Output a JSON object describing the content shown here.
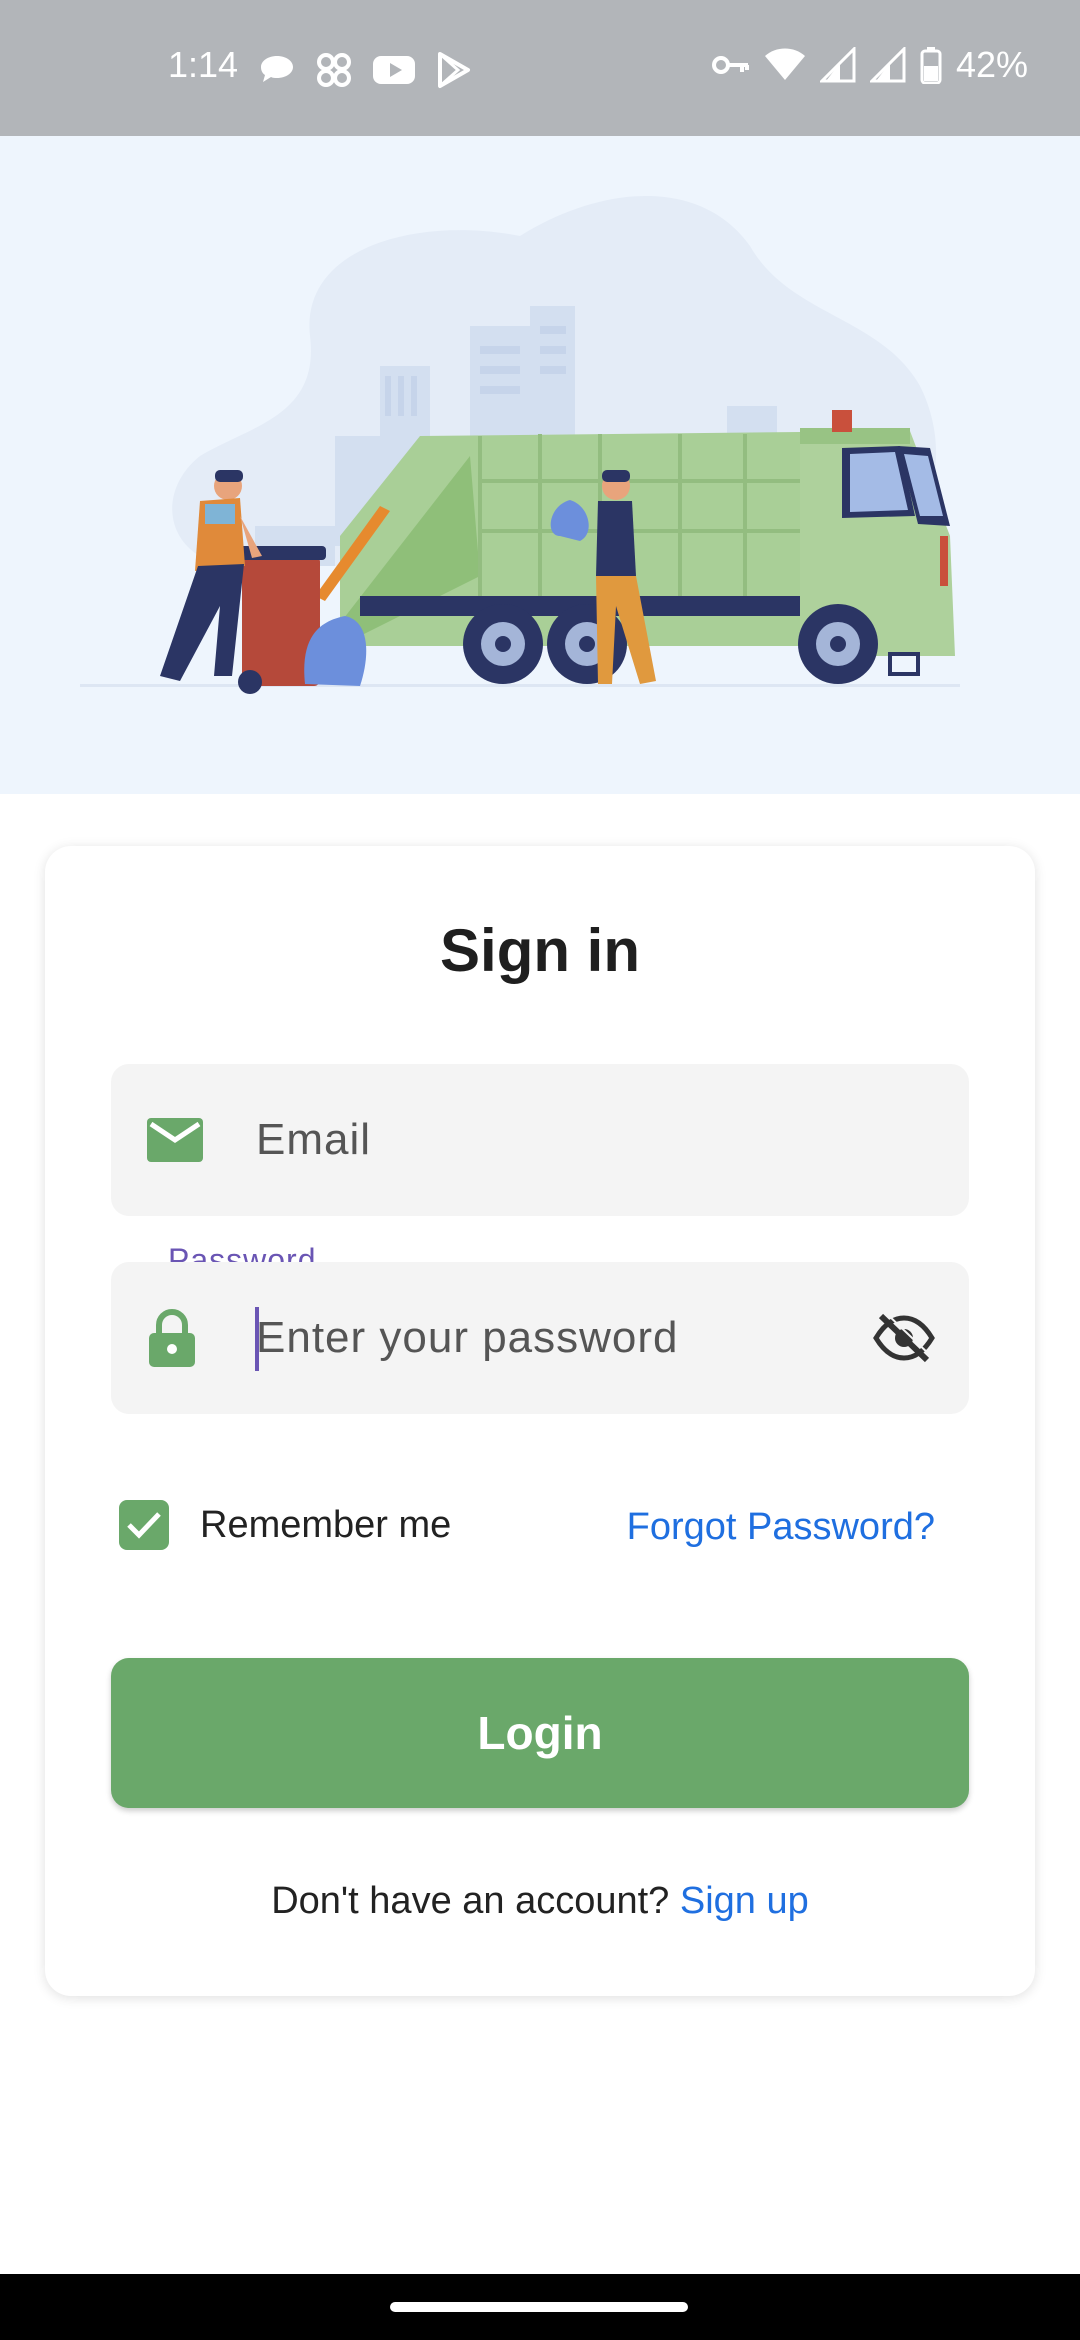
{
  "status_bar": {
    "time": "1:14",
    "battery_percent": "42%",
    "notification_icons": [
      "chat-bubble-icon",
      "shuffle-app-icon",
      "youtube-icon",
      "play-store-icon"
    ],
    "system_icons": [
      "vpn-key-icon",
      "wifi-icon",
      "signal-icon",
      "signal-icon-2",
      "battery-icon"
    ]
  },
  "hero": {
    "illustration": "garbage-truck-illustration"
  },
  "signin": {
    "title": "Sign in",
    "email": {
      "placeholder": "Email",
      "icon": "mail-icon"
    },
    "password": {
      "label": "Password",
      "placeholder": "Enter your password",
      "icon": "lock-icon",
      "toggle_icon": "visibility-off-icon"
    },
    "remember_me": {
      "label": "Remember me",
      "checked": true
    },
    "forgot_password": "Forgot Password?",
    "login_button": "Login",
    "signup_prompt": "Don't have an account?",
    "signup_link": "Sign up"
  },
  "colors": {
    "accent_green": "#6aa86a",
    "link_blue": "#1f6fe0",
    "focus_purple": "#6a55b4",
    "status_bar": "#b2b5b9",
    "hero_bg": "#eef5fd"
  }
}
